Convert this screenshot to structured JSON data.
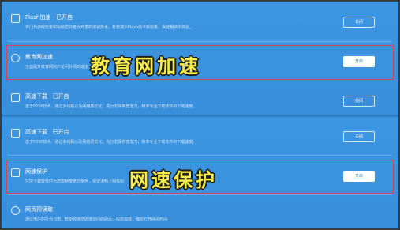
{
  "panel_top": {
    "rows": [
      {
        "title": "Flash加速 · 已开启",
        "desc": "专门为游戏玩家和视频爱好者而开发的加速技术，有效减少Flash的卡顿现象，保证畅快的体验。",
        "button": "关闭",
        "icon": "flash-icon"
      },
      {
        "title": "教育网加速",
        "desc": "全面提升教育网用户访问外网的速度",
        "button": "开启",
        "icon": "gauge-icon"
      },
      {
        "title": "高速下载 · 已开启",
        "desc": "基于P2SP技术，通过多线程以及网络层优化，充分发挥带宽潜力，精准专业下载软件的下载速度。",
        "button": "关闭",
        "icon": "download-icon"
      }
    ]
  },
  "panel_bottom": {
    "rows": [
      {
        "title": "高速下载 · 已开启",
        "desc": "基于P2SP技术，通过多线程以及网络层优化，充分发挥带宽潜力，精准专业下载软件的下载速度。",
        "button": "关闭",
        "icon": "download-icon"
      },
      {
        "title": "网速保护",
        "desc": "在您下载软件时为您限制带宽的使用，保证流畅上网体验",
        "button": "开启",
        "icon": "shield-icon"
      },
      {
        "title": "网页预读取",
        "desc": "通过用户的行为习惯，智能预测您即将访问的网页，提前加载，缩短打开网页时间",
        "button": "",
        "icon": "globe-icon"
      }
    ]
  },
  "overlays": {
    "top": "教育网加速",
    "bottom": "网速保护"
  },
  "colors": {
    "background": "#3a93de",
    "highlight": "#d9454b",
    "overlay_text": "#f7ed4d"
  }
}
